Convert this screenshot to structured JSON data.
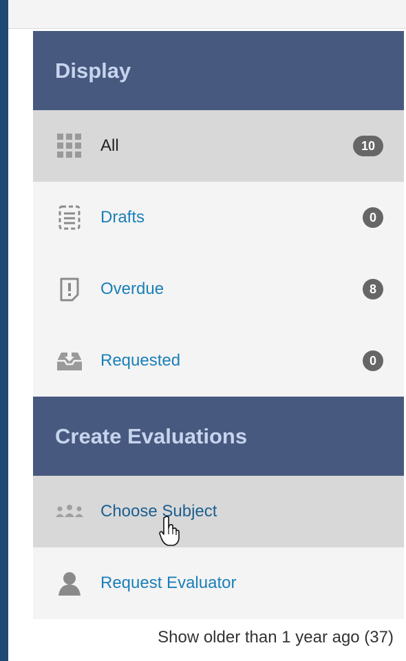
{
  "display_section": {
    "title": "Display",
    "items": [
      {
        "label": "All",
        "count": "10",
        "icon": "grid-icon",
        "active": true
      },
      {
        "label": "Drafts",
        "count": "0",
        "icon": "draft-document-icon"
      },
      {
        "label": "Overdue",
        "count": "8",
        "icon": "overdue-alert-icon"
      },
      {
        "label": "Requested",
        "count": "0",
        "icon": "inbox-download-icon"
      }
    ]
  },
  "create_section": {
    "title": "Create Evaluations",
    "items": [
      {
        "label": "Choose Subject",
        "icon": "group-users-icon",
        "hovered": true
      },
      {
        "label": "Request Evaluator",
        "icon": "user-icon"
      }
    ]
  },
  "footer": {
    "older_link": "Show older than 1 year ago (37)"
  },
  "colors": {
    "header_bg": "#48597f",
    "header_text": "#c7d4ee",
    "link": "#1a7fb8",
    "badge_bg": "#666666",
    "active_bg": "#d8d8d8"
  }
}
